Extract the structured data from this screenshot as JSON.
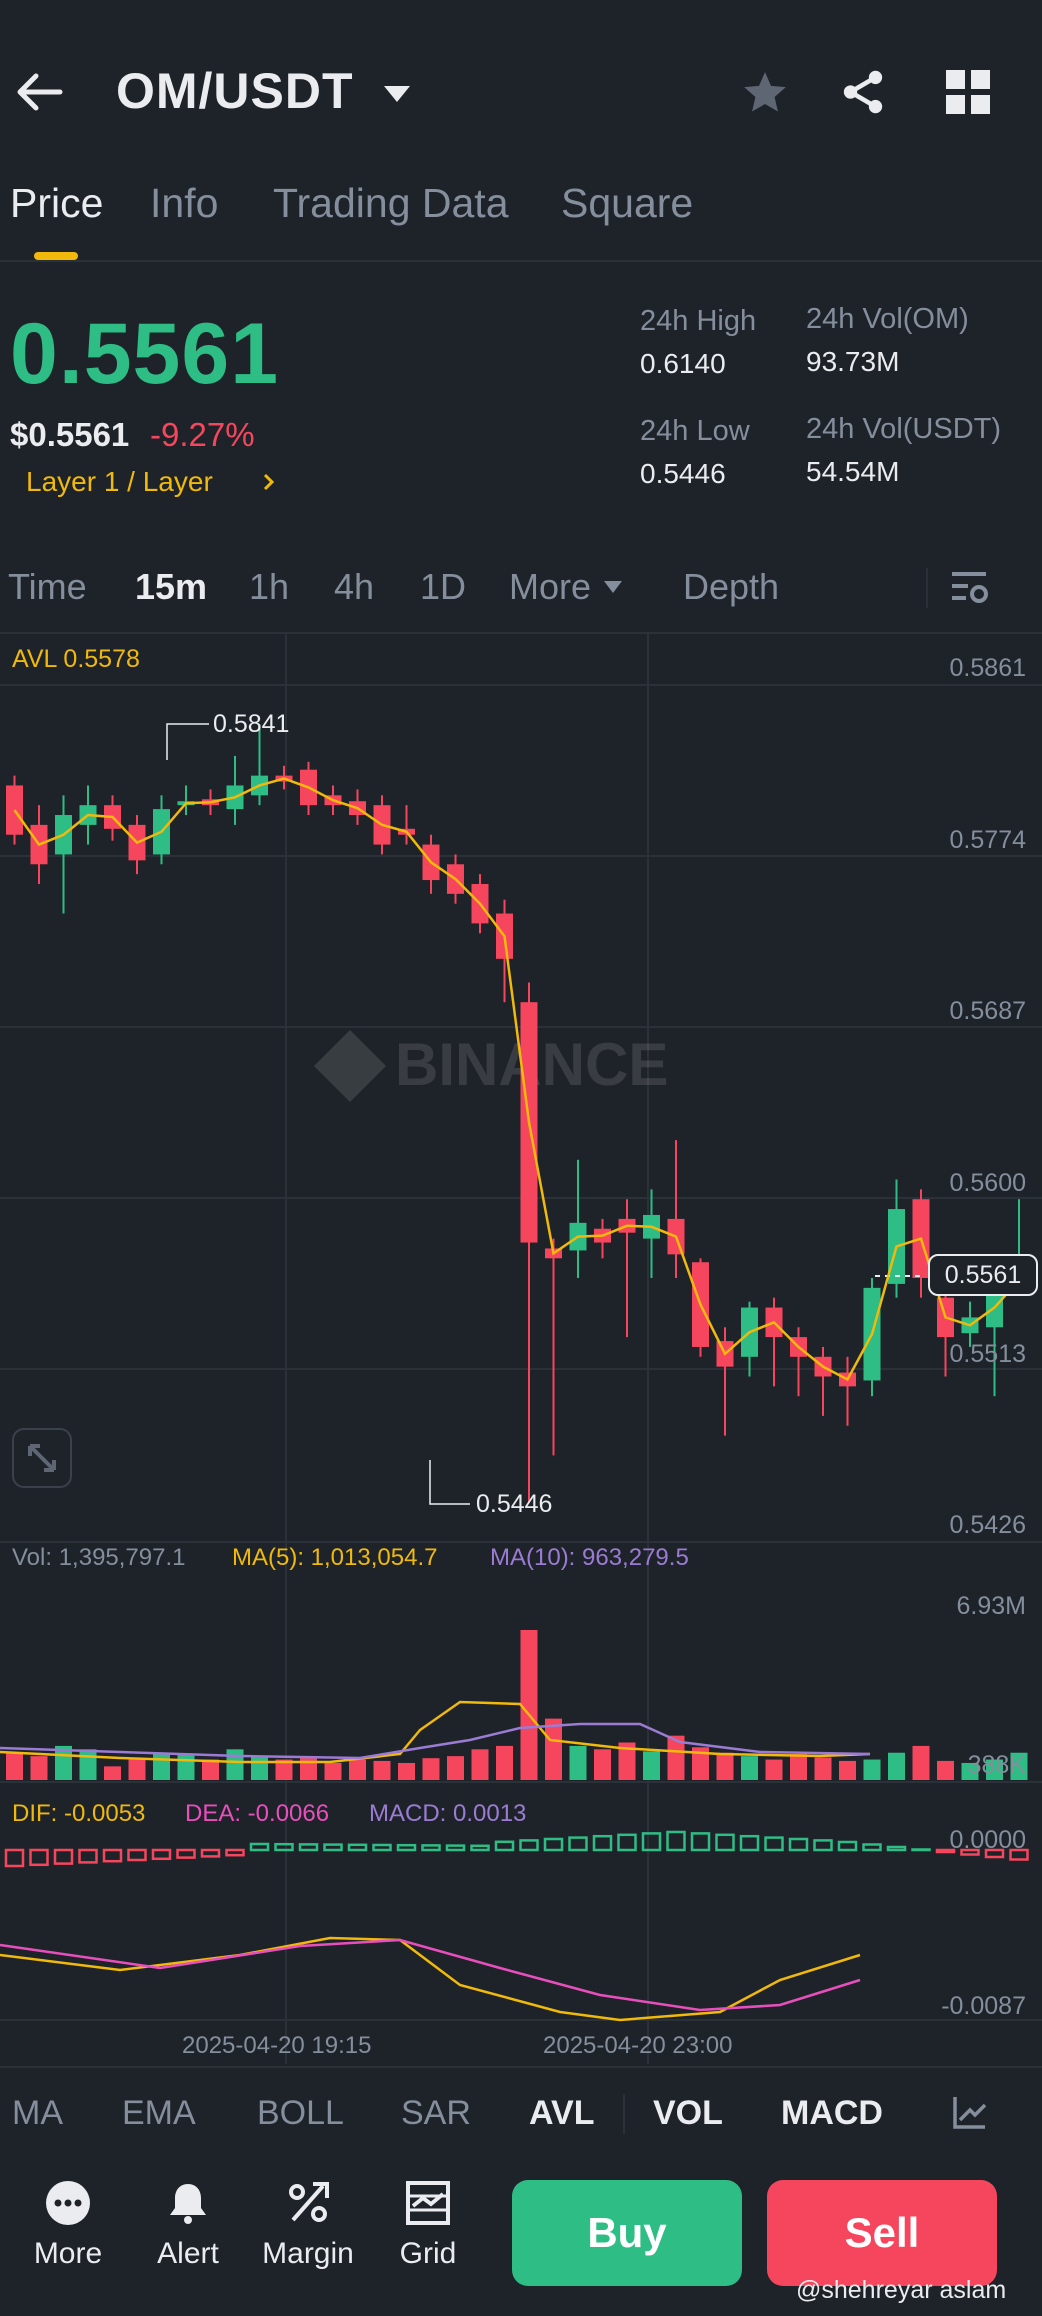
{
  "header": {
    "pair": "OM/USDT"
  },
  "tabs": [
    {
      "label": "Price",
      "active": true
    },
    {
      "label": "Info"
    },
    {
      "label": "Trading Data"
    },
    {
      "label": "Square"
    }
  ],
  "price": {
    "last": "0.5561",
    "usd": "$0.5561",
    "change": "-9.27%",
    "category": "Layer 1 / Layer",
    "high_label": "24h High",
    "high": "0.6140",
    "low_label": "24h Low",
    "low": "0.5446",
    "vol_om_label": "24h Vol(OM)",
    "vol_om": "93.73M",
    "vol_usdt_label": "24h Vol(USDT)",
    "vol_usdt": "54.54M"
  },
  "intervals": [
    "Time",
    "15m",
    "1h",
    "4h",
    "1D",
    "More",
    "Depth"
  ],
  "main_chart": {
    "avl_label": "AVL 0.5578",
    "y_ticks": [
      "0.5861",
      "0.5774",
      "0.5687",
      "0.5600",
      "0.5513",
      "0.5426"
    ],
    "high_marker": "0.5841",
    "low_marker": "0.5446",
    "current_price": "0.5561",
    "watermark": "BINANCE"
  },
  "volume": {
    "vol": "Vol: 1,395,797.1",
    "ma5": "MA(5): 1,013,054.7",
    "ma10": "MA(10): 963,279.5",
    "y_top": "6.93M",
    "y_bottom": "388K"
  },
  "macd": {
    "dif": "DIF: -0.0053",
    "dea": "DEA: -0.0066",
    "macd": "MACD: 0.0013",
    "y_top": "0.0000",
    "y_bottom": "-0.0087"
  },
  "x_axis": [
    "2025-04-20 19:15",
    "2025-04-20 23:00"
  ],
  "indicators": [
    "MA",
    "EMA",
    "BOLL",
    "SAR",
    "AVL",
    "VOL",
    "MACD"
  ],
  "bottom_nav": [
    {
      "label": "More",
      "icon": "more-icon"
    },
    {
      "label": "Alert",
      "icon": "bell-icon"
    },
    {
      "label": "Margin",
      "icon": "margin-icon"
    },
    {
      "label": "Grid",
      "icon": "grid-icon"
    }
  ],
  "actions": {
    "buy": "Buy",
    "sell": "Sell"
  },
  "watermark_credit": "@shehreyar aslam",
  "colors": {
    "bg": "#1e2329",
    "up": "#2ebd85",
    "down": "#f6465d",
    "accent": "#f0b90b",
    "purple": "#9b7bd4",
    "pink": "#e84fbd"
  }
}
